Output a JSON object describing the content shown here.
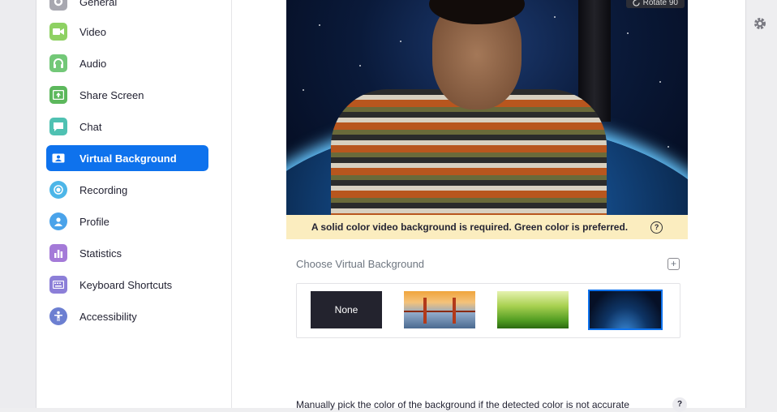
{
  "sidebar": {
    "items": [
      {
        "label": "General",
        "icon": "gear-icon",
        "color": "#9a9aa3",
        "active": false
      },
      {
        "label": "Video",
        "icon": "video-icon",
        "color": "#8ed163",
        "active": false
      },
      {
        "label": "Audio",
        "icon": "headphones-icon",
        "color": "#73c878",
        "active": false
      },
      {
        "label": "Share Screen",
        "icon": "share-screen-icon",
        "color": "#5cb85c",
        "active": false
      },
      {
        "label": "Chat",
        "icon": "chat-icon",
        "color": "#4fc1b2",
        "active": false
      },
      {
        "label": "Virtual Background",
        "icon": "virtual-background-icon",
        "color": "#0e72ed",
        "active": true
      },
      {
        "label": "Recording",
        "icon": "recording-icon",
        "color": "#4db6e8",
        "active": false
      },
      {
        "label": "Profile",
        "icon": "profile-icon",
        "color": "#4aa3ea",
        "active": false
      },
      {
        "label": "Statistics",
        "icon": "statistics-icon",
        "color": "#a47ad8",
        "active": false
      },
      {
        "label": "Keyboard Shortcuts",
        "icon": "keyboard-icon",
        "color": "#8c7fd8",
        "active": false
      },
      {
        "label": "Accessibility",
        "icon": "accessibility-icon",
        "color": "#6c7fd1",
        "active": false
      }
    ]
  },
  "preview": {
    "rotate_label": "Rotate 90"
  },
  "notice": {
    "text": "A solid color video background is required. Green color is preferred.",
    "help": "?"
  },
  "choose": {
    "label": "Choose Virtual Background",
    "add": "+",
    "options": [
      {
        "label": "None",
        "name": "none",
        "selected": false
      },
      {
        "label": "",
        "name": "golden-gate-bridge",
        "selected": false
      },
      {
        "label": "",
        "name": "grass",
        "selected": false
      },
      {
        "label": "",
        "name": "space-earth",
        "selected": true
      }
    ]
  },
  "manual": {
    "text": "Manually pick the color of the background if the detected color is not accurate",
    "help": "?"
  },
  "colors": {
    "accent": "#0e72ed",
    "notice_bg": "#fbedbf"
  }
}
